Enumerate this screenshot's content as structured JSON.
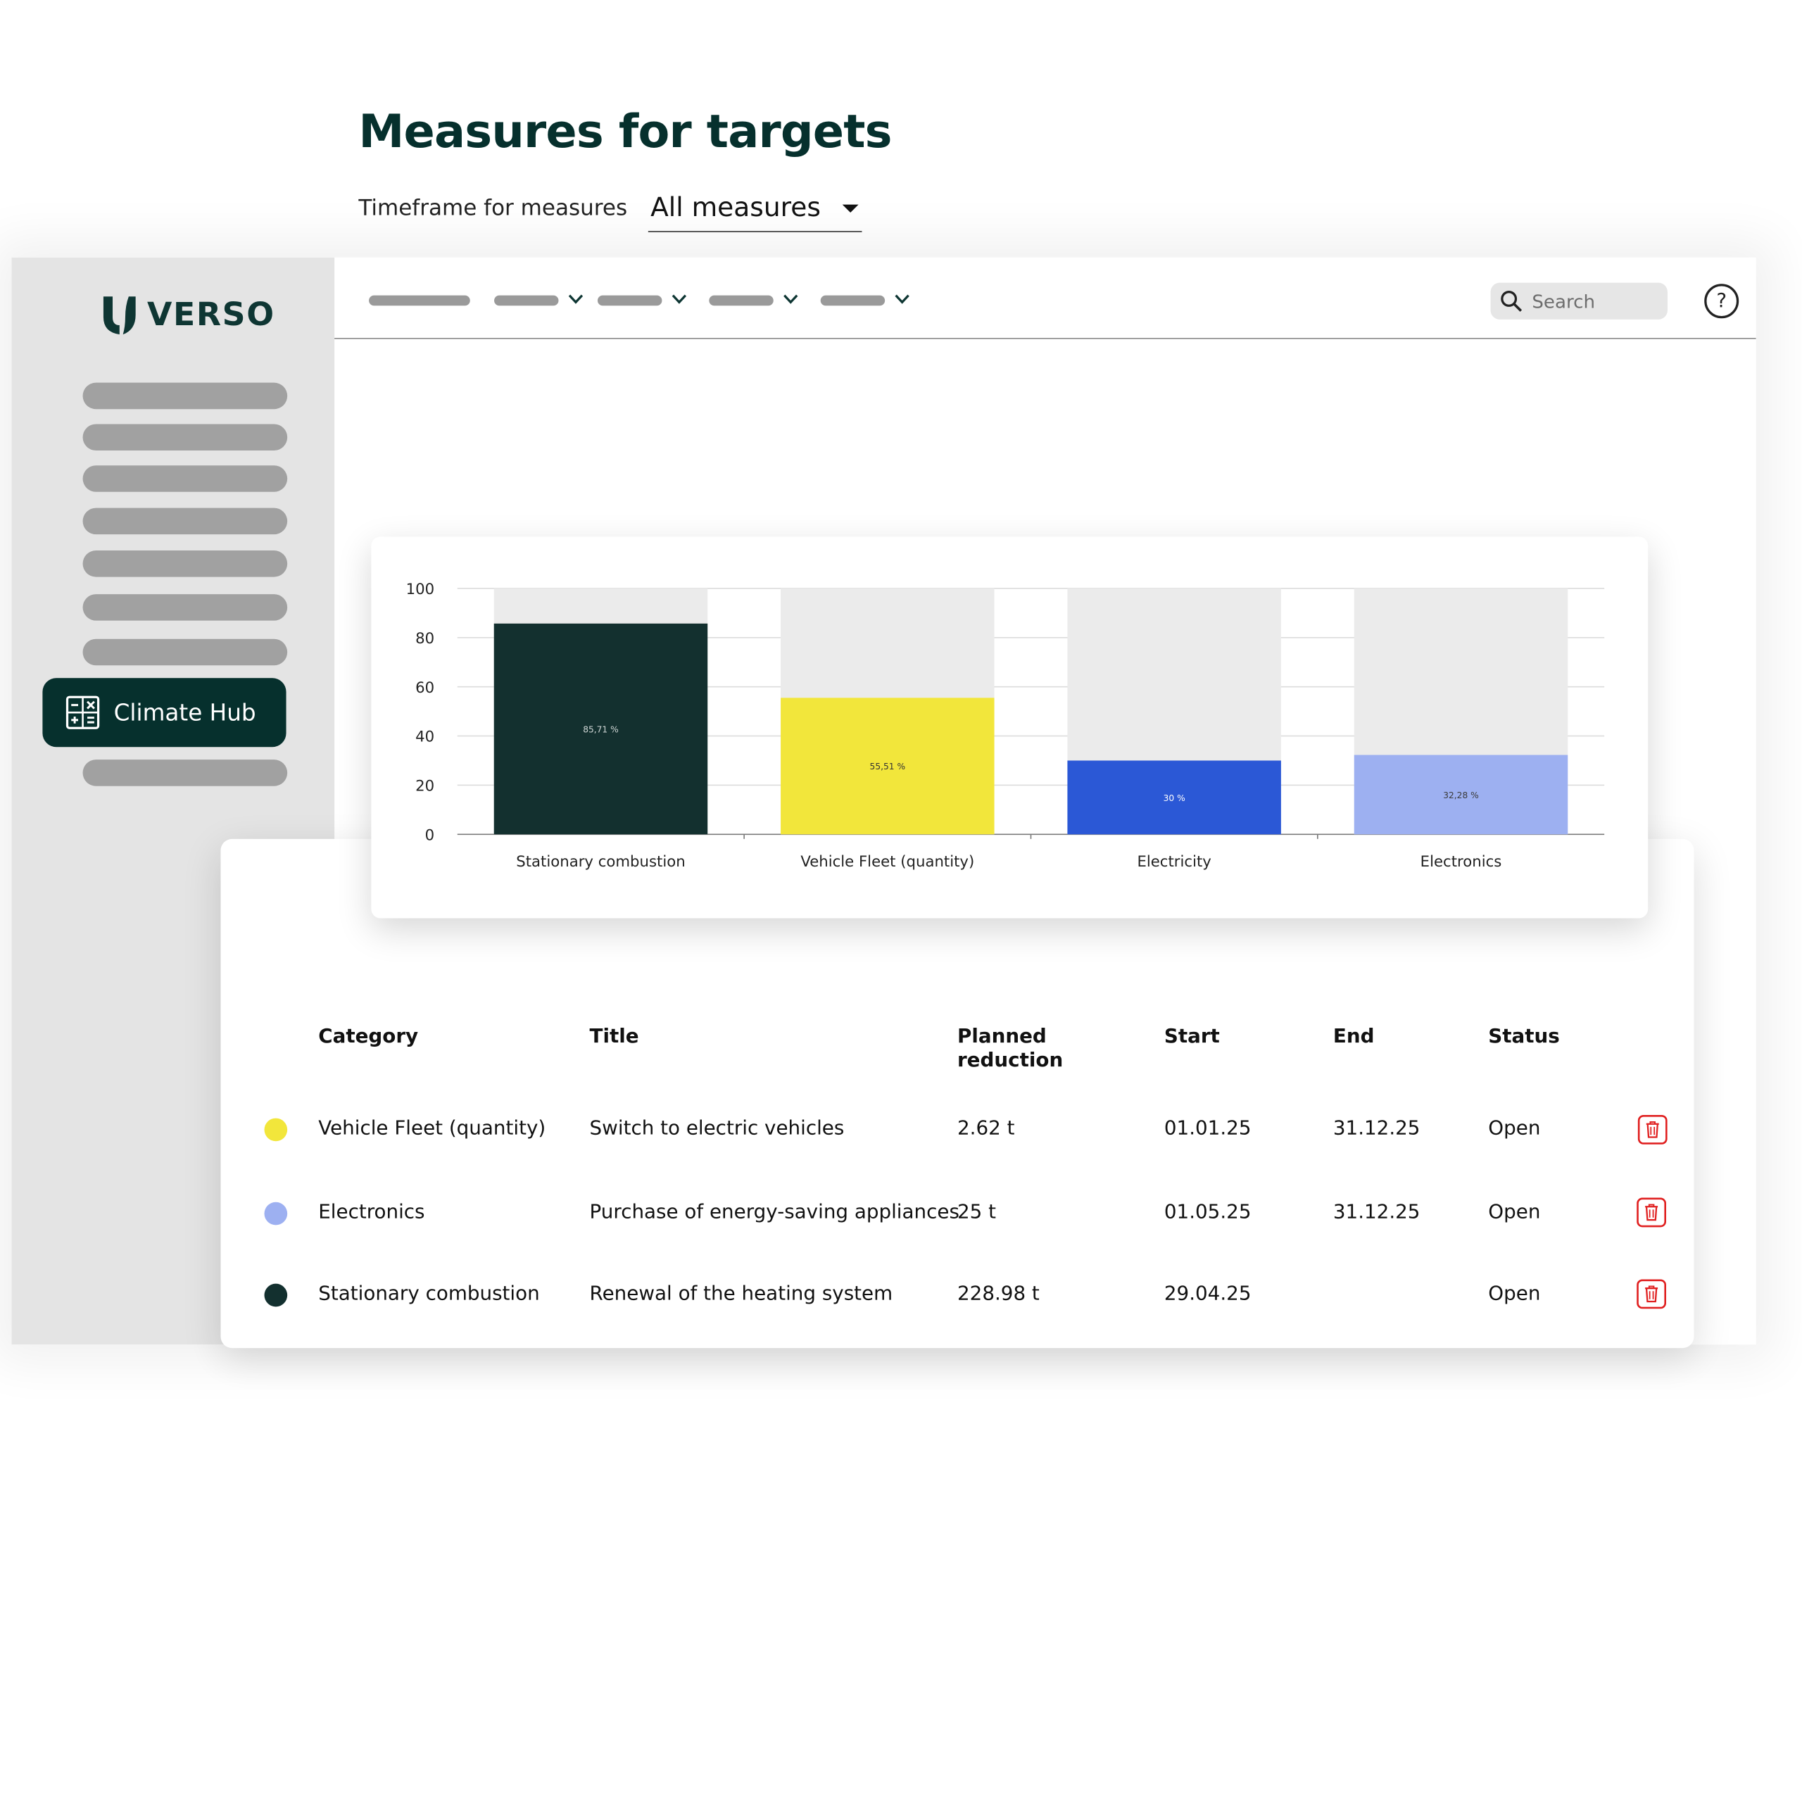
{
  "brand": {
    "name": "VERSO"
  },
  "sidebar": {
    "active_item": {
      "label": "Climate Hub"
    }
  },
  "topbar": {
    "search": {
      "placeholder": "Search"
    },
    "help_label": "?"
  },
  "page": {
    "title": "Measures for targets",
    "timeframe": {
      "label": "Timeframe for measures",
      "value": "All measures"
    }
  },
  "colors": {
    "dark_green": "#06302d",
    "yellow": "#f2e63b",
    "blue": "#2b58d6",
    "light_blue": "#9db0f1",
    "track": "#ebebeb",
    "delete_red": "#e02020"
  },
  "chart_data": {
    "type": "bar",
    "title": "",
    "xlabel": "",
    "ylabel": "",
    "ylim": [
      0,
      100
    ],
    "yticks": [
      0,
      20,
      40,
      60,
      80,
      100
    ],
    "categories": [
      "Stationary combustion",
      "Vehicle Fleet (quantity)",
      "Electricity",
      "Electronics"
    ],
    "values": [
      85.71,
      55.51,
      30,
      32.28
    ],
    "labels": [
      "85,71 %",
      "55,51 %",
      "30 %",
      "32,28 %"
    ],
    "colors": [
      "#13302f",
      "#f2e63b",
      "#2b58d6",
      "#9db0f1"
    ],
    "label_colors": [
      "#cfd6d5",
      "#333333",
      "#ffffff",
      "#3a3a3a"
    ],
    "background_track": 100,
    "grid": true,
    "legend": "none"
  },
  "table": {
    "headers": {
      "category": "Category",
      "title": "Title",
      "planned_line1": "Planned",
      "planned_line2": "reduction",
      "start": "Start",
      "end": "End",
      "status": "Status"
    },
    "rows": [
      {
        "color": "#f2e63b",
        "category": "Vehicle Fleet (quantity)",
        "title": "Switch to electric vehicles",
        "planned": "2.62 t",
        "start": "01.01.25",
        "end": "31.12.25",
        "status": "Open"
      },
      {
        "color": "#9db0f1",
        "category": "Electronics",
        "title": "Purchase of energy-saving appliances",
        "planned": "25 t",
        "start": "01.05.25",
        "end": "31.12.25",
        "status": "Open"
      },
      {
        "color": "#13302f",
        "category": "Stationary combustion",
        "title": "Renewal of the heating system",
        "planned": "228.98 t",
        "start": "29.04.25",
        "end": "",
        "status": "Open"
      }
    ]
  }
}
